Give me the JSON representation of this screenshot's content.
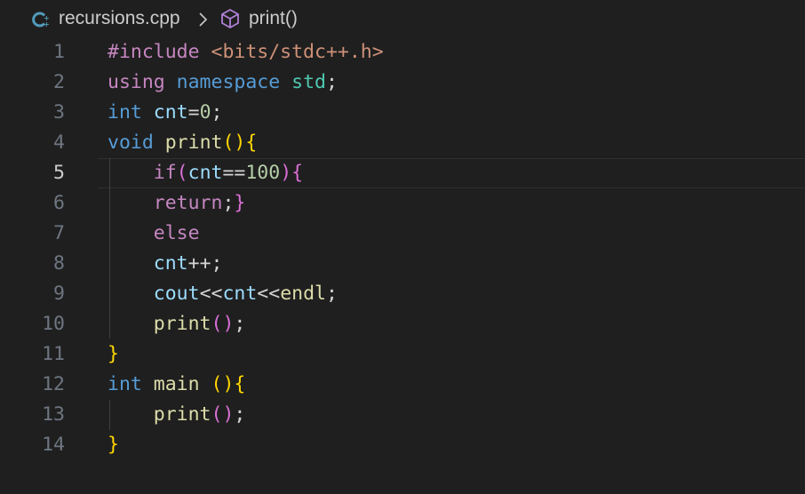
{
  "breadcrumb": {
    "file_icon": "cpp-file-icon",
    "file": "recursions.cpp",
    "separator_icon": "chevron-right-icon",
    "symbol_icon": "method-cube-icon",
    "symbol": "print()"
  },
  "editor": {
    "active_line": 5,
    "lines": [
      {
        "n": "1",
        "t": [
          [
            "#include ",
            "pp"
          ],
          [
            "<bits/stdc++.h>",
            "str"
          ]
        ]
      },
      {
        "n": "2",
        "t": [
          [
            "using ",
            "ctl"
          ],
          [
            "namespace ",
            "kw"
          ],
          [
            "std",
            "type"
          ],
          [
            ";",
            "op"
          ]
        ]
      },
      {
        "n": "3",
        "t": [
          [
            "int ",
            "kw"
          ],
          [
            "cnt",
            "var"
          ],
          [
            "=",
            "op"
          ],
          [
            "0",
            "num"
          ],
          [
            ";",
            "op"
          ]
        ]
      },
      {
        "n": "4",
        "t": [
          [
            "void ",
            "kw"
          ],
          [
            "print",
            "fn"
          ],
          [
            "()",
            "b1"
          ],
          [
            "{",
            "b1"
          ]
        ]
      },
      {
        "n": "5",
        "t": [
          [
            "    ",
            "op"
          ],
          [
            "if",
            "ctl"
          ],
          [
            "(",
            "b2"
          ],
          [
            "cnt",
            "var"
          ],
          [
            "==",
            "op"
          ],
          [
            "100",
            "num"
          ],
          [
            ")",
            "b2"
          ],
          [
            "{",
            "b2"
          ]
        ]
      },
      {
        "n": "6",
        "t": [
          [
            "    ",
            "op"
          ],
          [
            "return",
            "ctl"
          ],
          [
            ";",
            "op"
          ],
          [
            "}",
            "b2"
          ]
        ]
      },
      {
        "n": "7",
        "t": [
          [
            "    ",
            "op"
          ],
          [
            "else",
            "ctl"
          ]
        ]
      },
      {
        "n": "8",
        "t": [
          [
            "    ",
            "op"
          ],
          [
            "cnt",
            "var"
          ],
          [
            "++;",
            "op"
          ]
        ]
      },
      {
        "n": "9",
        "t": [
          [
            "    ",
            "op"
          ],
          [
            "cout",
            "var"
          ],
          [
            "<<",
            "op"
          ],
          [
            "cnt",
            "var"
          ],
          [
            "<<",
            "op"
          ],
          [
            "endl",
            "fn"
          ],
          [
            ";",
            "op"
          ]
        ]
      },
      {
        "n": "10",
        "t": [
          [
            "    ",
            "op"
          ],
          [
            "print",
            "fn"
          ],
          [
            "()",
            "b2"
          ],
          [
            ";",
            "op"
          ]
        ]
      },
      {
        "n": "11",
        "t": [
          [
            "}",
            "b1"
          ]
        ]
      },
      {
        "n": "12",
        "t": [
          [
            "int ",
            "kw"
          ],
          [
            "main ",
            "fn"
          ],
          [
            "()",
            "b1"
          ],
          [
            "{",
            "b1"
          ]
        ]
      },
      {
        "n": "13",
        "t": [
          [
            "    ",
            "op"
          ],
          [
            "print",
            "fn"
          ],
          [
            "()",
            "b2"
          ],
          [
            ";",
            "op"
          ]
        ]
      },
      {
        "n": "14",
        "t": [
          [
            "}",
            "b1"
          ]
        ]
      }
    ]
  },
  "colors": {
    "background": "#1f1f1f",
    "line_number": "#6e7681",
    "line_number_active": "#cccccc",
    "bracket_gold": "#ffd700",
    "bracket_pink": "#da70d6",
    "keyword_blue": "#569cd6",
    "control_purple": "#c586c0"
  }
}
